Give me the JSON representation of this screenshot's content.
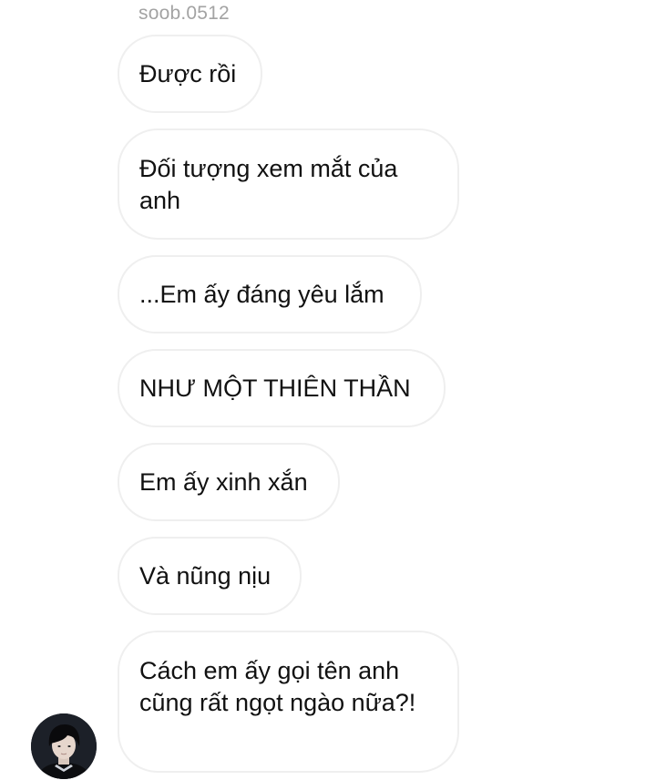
{
  "chat": {
    "sender": "soob.0512",
    "messages": [
      "Được rồi",
      "Đối tượng xem mắt của anh",
      "...Em ấy đáng yêu lắm",
      "NHƯ MỘT THIÊN THẦN",
      "Em ấy xinh xắn",
      "Và nũng nịu",
      "Cách em ấy gọi tên anh cũng rất ngọt ngào nữa?!"
    ],
    "avatar_icon": "user-avatar",
    "colors": {
      "bubble_border": "#efefef",
      "text": "#111111",
      "sender": "#a3a3a3"
    }
  }
}
